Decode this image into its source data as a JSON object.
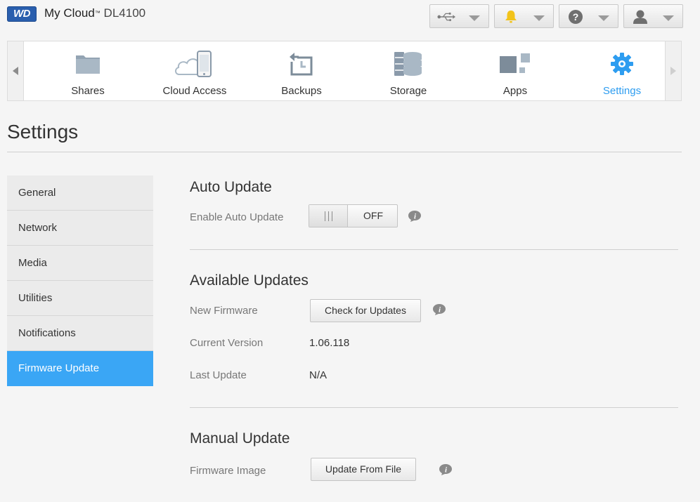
{
  "header": {
    "logo_text": "WD",
    "brand": "My Cloud",
    "trademark": "™",
    "model": "DL4100",
    "buttons": [
      {
        "name": "usb",
        "icon": "usb-icon"
      },
      {
        "name": "alerts",
        "icon": "bell-icon",
        "color": "#f2c31a"
      },
      {
        "name": "help",
        "icon": "help-icon"
      },
      {
        "name": "user",
        "icon": "user-icon"
      }
    ]
  },
  "nav": {
    "items": [
      {
        "label": "Shares",
        "icon": "folder-icon"
      },
      {
        "label": "Cloud Access",
        "icon": "cloud-device-icon"
      },
      {
        "label": "Backups",
        "icon": "backup-icon"
      },
      {
        "label": "Storage",
        "icon": "storage-icon"
      },
      {
        "label": "Apps",
        "icon": "apps-icon"
      },
      {
        "label": "Settings",
        "icon": "gear-icon",
        "active": true
      }
    ],
    "active_color": "#2e9df0"
  },
  "page": {
    "title": "Settings"
  },
  "sidebar": {
    "items": [
      {
        "label": "General"
      },
      {
        "label": "Network"
      },
      {
        "label": "Media"
      },
      {
        "label": "Utilities"
      },
      {
        "label": "Notifications"
      },
      {
        "label": "Firmware Update",
        "active": true
      }
    ],
    "active_color": "#3aa6f5"
  },
  "auto_update": {
    "title": "Auto Update",
    "enable_label": "Enable Auto Update",
    "toggle_state": "OFF"
  },
  "available_updates": {
    "title": "Available Updates",
    "new_firmware_label": "New Firmware",
    "check_button": "Check for Updates",
    "current_version_label": "Current Version",
    "current_version": "1.06.118",
    "last_update_label": "Last Update",
    "last_update": "N/A"
  },
  "manual_update": {
    "title": "Manual Update",
    "firmware_image_label": "Firmware Image",
    "update_button": "Update From File"
  }
}
